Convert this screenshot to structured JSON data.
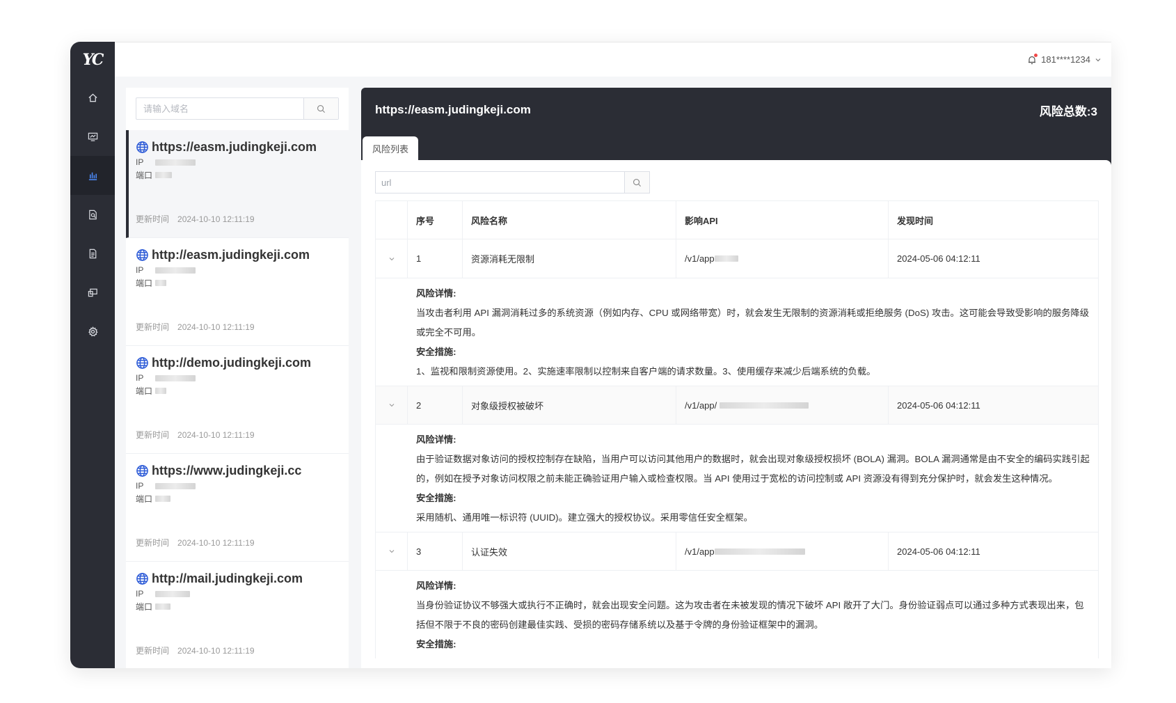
{
  "app": {
    "logo": "YC"
  },
  "sidebar": {
    "items": [
      {
        "icon": "home-icon"
      },
      {
        "icon": "monitor-icon"
      },
      {
        "icon": "bar-chart-icon",
        "active": true
      },
      {
        "icon": "report-search-icon"
      },
      {
        "icon": "document-icon"
      },
      {
        "icon": "devices-icon"
      },
      {
        "icon": "gear-icon"
      }
    ]
  },
  "topbar": {
    "user": "181****1234"
  },
  "domain_panel": {
    "search_placeholder": "请输入域名",
    "ip_label": "IP",
    "port_label": "端口",
    "time_label": "更新时间",
    "domains": [
      {
        "url": "https://easm.judingkeji.com",
        "updated": "2024-10-10 12:11:19",
        "active": true
      },
      {
        "url": "http://easm.judingkeji.com",
        "updated": "2024-10-10 12:11:19"
      },
      {
        "url": "http://demo.judingkeji.com",
        "updated": "2024-10-10 12:11:19"
      },
      {
        "url": "https://www.judingkeji.cc",
        "updated": "2024-10-10 12:11:19"
      },
      {
        "url": "http://mail.judingkeji.com",
        "updated": "2024-10-10 12:11:19"
      }
    ]
  },
  "main": {
    "title": "https://easm.judingkeji.com",
    "risk_total": "风险总数:3",
    "tab": "风险列表",
    "search_placeholder": "url",
    "columns": [
      "序号",
      "风险名称",
      "影响API",
      "发现时间"
    ],
    "detail_label": "风险详情:",
    "measure_label": "安全措施:",
    "rows": [
      {
        "no": "1",
        "name": "资源消耗无限制",
        "api": "/v1/app",
        "time": "2024-05-06 04:12:11",
        "detail": "当攻击者利用 API 漏洞消耗过多的系统资源（例如内存、CPU 或网络带宽）时，就会发生无限制的资源消耗或拒绝服务 (DoS) 攻击。这可能会导致受影响的服务降级或完全不可用。",
        "measure": "1、监视和限制资源使用。2、实施速率限制以控制来自客户端的请求数量。3、使用缓存来减少后端系统的负载。"
      },
      {
        "no": "2",
        "name": "对象级授权被破坏",
        "api": "/v1/app/",
        "time": "2024-05-06 04:12:11",
        "detail": "由于验证数据对象访问的授权控制存在缺陷，当用户可以访问其他用户的数据时，就会出现对象级授权损坏 (BOLA) 漏洞。BOLA 漏洞通常是由不安全的编码实践引起的，例如在授予对象访问权限之前未能正确验证用户输入或检查权限。当 API 使用过于宽松的访问控制或 API 资源没有得到充分保护时，就会发生这种情况。",
        "measure": "采用随机、通用唯一标识符 (UUID)。建立强大的授权协议。采用零信任安全框架。"
      },
      {
        "no": "3",
        "name": "认证失效",
        "api": "/v1/app",
        "time": "2024-05-06 04:12:11",
        "detail": "当身份验证协议不够强大或执行不正确时，就会出现安全问题。这为攻击者在未被发现的情况下破坏 API 敞开了大门。身份验证弱点可以通过多种方式表现出来，包括但不限于不良的密码创建最佳实践、受损的密码存储系统以及基于令牌的身份验证框架中的漏洞。",
        "measure": ""
      }
    ]
  }
}
